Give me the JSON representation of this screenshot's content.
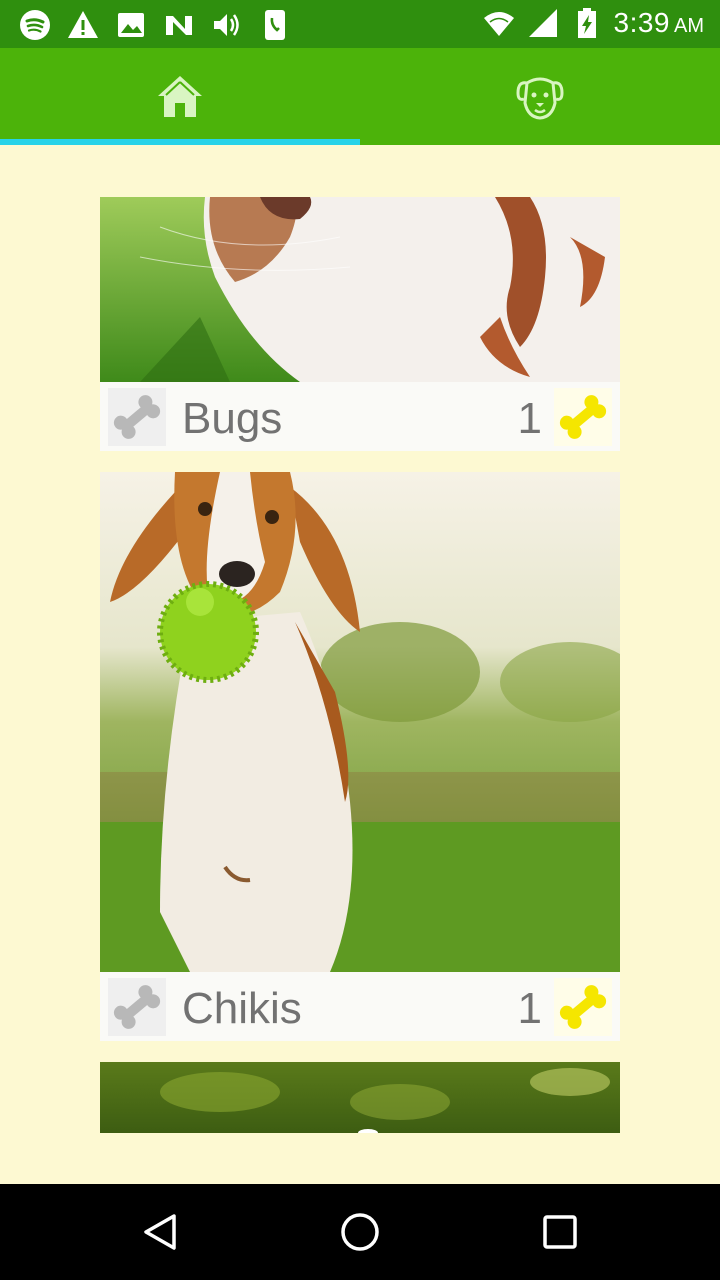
{
  "status_bar": {
    "time": "3:39",
    "ampm": "AM",
    "left_icons": [
      "spotify-icon",
      "warning-icon",
      "image-icon",
      "n-app-icon",
      "volume-icon",
      "phone-app-icon"
    ],
    "right_icons": [
      "wifi-icon",
      "signal-icon",
      "battery-charging-icon"
    ]
  },
  "tabs": [
    {
      "icon": "home-icon",
      "selected": true
    },
    {
      "icon": "dog-face-icon",
      "selected": false
    }
  ],
  "colors": {
    "status_bar": "#2f8f0e",
    "tab_bar": "#4cb30a",
    "tab_indicator": "#27d3e8",
    "background": "#fdf9d2",
    "bone_inactive": "#b8b8b8",
    "bone_active": "#f5e600"
  },
  "pets": [
    {
      "name": "Bugs",
      "count": "1"
    },
    {
      "name": "Chikis",
      "count": "1"
    }
  ],
  "nav": [
    "back-icon",
    "home-circle-icon",
    "recents-icon"
  ]
}
